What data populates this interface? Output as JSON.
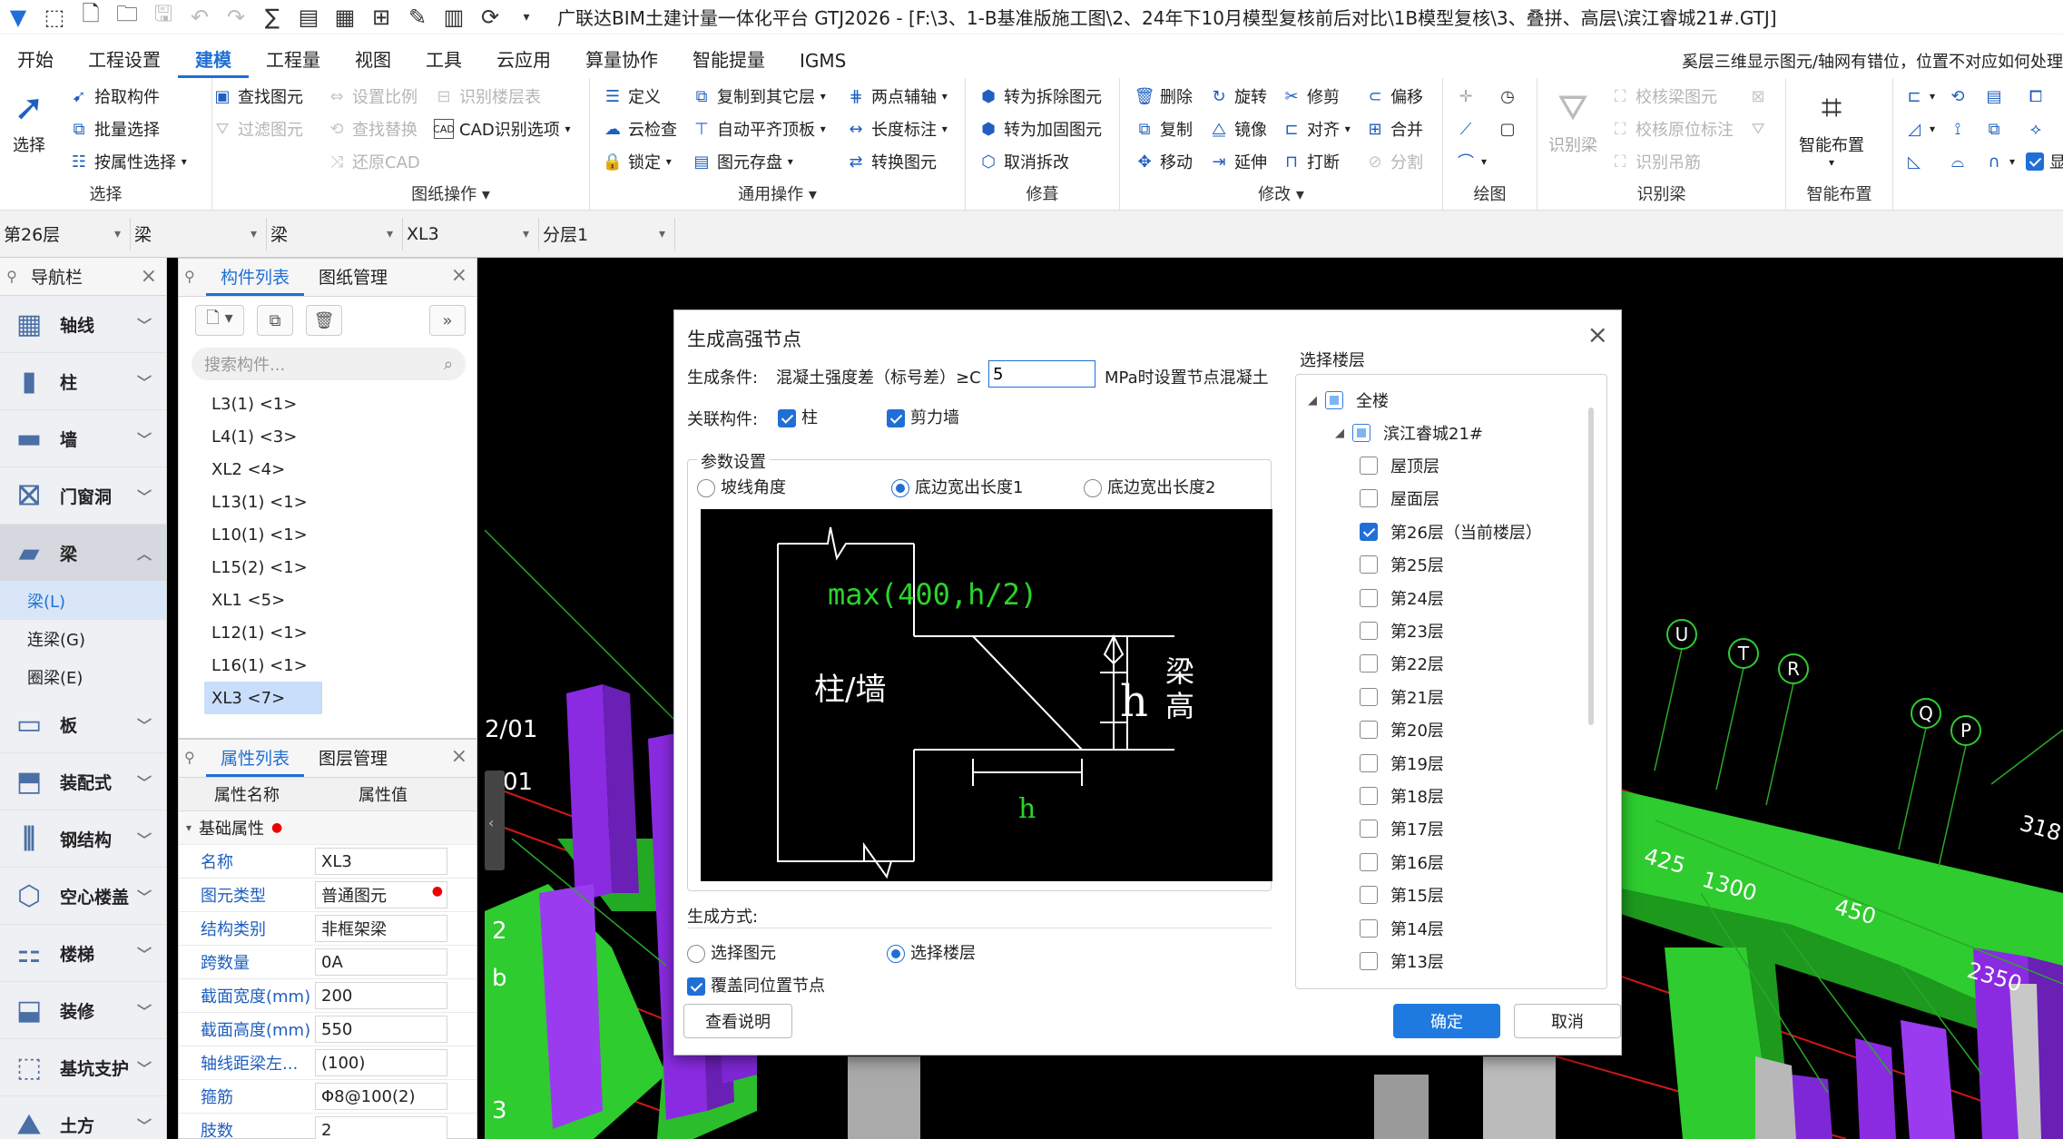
{
  "app": {
    "title": "广联达BIM土建计量一体化平台 GTJ2026 - [F:\\3、1-B基准版施工图\\2、24年下10月模型复核前后对比\\1B模型复核\\3、叠拼、高层\\滨江睿城21#.GTJ]",
    "notice": "奚层三维显示图元/轴网有错位，位置不对应如何处理"
  },
  "menus": [
    "开始",
    "工程设置",
    "建模",
    "工程量",
    "视图",
    "工具",
    "云应用",
    "算量协作",
    "智能提量",
    "IGMS"
  ],
  "active_menu": "建模",
  "ribbon": {
    "select_group": {
      "label": "选择",
      "big": "选择",
      "items": [
        "拾取构件",
        "批量选择",
        "按属性选择"
      ]
    },
    "find_items": [
      "查找图元",
      "过滤图元"
    ],
    "drawing_ops": {
      "label": "图纸操作",
      "items": [
        "设置比例",
        "查找替换",
        "还原CAD",
        "识别楼层表",
        "CAD识别选项"
      ]
    },
    "general_ops": {
      "label": "通用操作",
      "items": [
        "定义",
        "云检查",
        "锁定",
        "复制到其它层",
        "自动平齐顶板",
        "图元存盘",
        "两点辅轴",
        "长度标注",
        "转换图元"
      ]
    },
    "modify_split": {
      "label": "修葺",
      "items": [
        "转为拆除图元",
        "转为加固图元",
        "取消拆改"
      ]
    },
    "modify": {
      "label": "修改",
      "items": [
        "删除",
        "旋转",
        "修剪",
        "偏移",
        "复制",
        "镜像",
        "对齐",
        "合并",
        "移动",
        "延伸",
        "打断",
        "分割"
      ]
    },
    "draw": {
      "label": "绘图"
    },
    "identify_beam": {
      "label": "识别梁",
      "big": "识别梁",
      "items": [
        "校核梁图元",
        "校核原位标注",
        "识别吊筋"
      ]
    },
    "smart_layout": {
      "label": "智能布置",
      "big": "智能布置"
    },
    "more_label": "显"
  },
  "selectors": [
    "第26层",
    "梁",
    "梁",
    "XL3",
    "分层1"
  ],
  "nav": {
    "title": "导航栏",
    "items": [
      {
        "label": "轴线",
        "icon": "grid-icon"
      },
      {
        "label": "柱",
        "icon": "column-icon"
      },
      {
        "label": "墙",
        "icon": "wall-icon"
      },
      {
        "label": "门窗洞",
        "icon": "door-window-icon"
      },
      {
        "label": "梁",
        "icon": "beam-icon",
        "open": true
      },
      {
        "label": "板",
        "icon": "slab-icon"
      },
      {
        "label": "装配式",
        "icon": "prefab-icon"
      },
      {
        "label": "钢结构",
        "icon": "steel-icon"
      },
      {
        "label": "空心楼盖",
        "icon": "hollow-floor-icon"
      },
      {
        "label": "楼梯",
        "icon": "stairs-icon"
      },
      {
        "label": "装修",
        "icon": "decoration-icon"
      },
      {
        "label": "基坑支护",
        "icon": "pit-support-icon"
      },
      {
        "label": "土方",
        "icon": "earthwork-icon"
      }
    ],
    "sub_items": [
      "梁(L)",
      "连梁(G)",
      "圈梁(E)"
    ],
    "active_sub": "梁(L)"
  },
  "components": {
    "tabs": [
      "构件列表",
      "图纸管理"
    ],
    "search_placeholder": "搜索构件...",
    "rows": [
      "L3(1) <1>",
      "L4(1) <3>",
      "XL2 <4>",
      "L13(1) <1>",
      "L10(1) <1>",
      "L15(2) <1>",
      "XL1 <5>",
      "L12(1) <1>",
      "L16(1) <1>",
      "XL3 <7>"
    ],
    "selected": "XL3 <7>"
  },
  "properties": {
    "tabs": [
      "属性列表",
      "图层管理"
    ],
    "header": [
      "属性名称",
      "属性值"
    ],
    "group": "基础属性",
    "rows": [
      {
        "name": "名称",
        "value": "XL3"
      },
      {
        "name": "图元类型",
        "value": "普通图元",
        "mark": true
      },
      {
        "name": "结构类别",
        "value": "非框架梁"
      },
      {
        "name": "跨数量",
        "value": "0A"
      },
      {
        "name": "截面宽度(mm)",
        "value": "200"
      },
      {
        "name": "截面高度(mm)",
        "value": "550"
      },
      {
        "name": "轴线距梁左...",
        "value": "(100)"
      },
      {
        "name": "箍筋",
        "value": "Φ8@100(2)"
      },
      {
        "name": "肢数",
        "value": "2"
      }
    ]
  },
  "viewport": {
    "axis_labels": [
      "U",
      "T",
      "R",
      "Q",
      "P"
    ],
    "dims": [
      "425",
      "1300",
      "450",
      "2350",
      "318"
    ],
    "side_labels": [
      "2/01",
      "01",
      "2",
      "b",
      "3"
    ]
  },
  "dialog": {
    "title": "生成高强节点",
    "condition_label": "生成条件:",
    "condition_text": "混凝土强度差（标号差）≥C",
    "condition_value": "5",
    "condition_suffix": "MPa时设置节点混凝土",
    "related_label": "关联构件:",
    "related": [
      {
        "label": "柱",
        "checked": true
      },
      {
        "label": "剪力墙",
        "checked": true
      }
    ],
    "params_legend": "参数设置",
    "param_options": [
      {
        "label": "坡线角度",
        "checked": false
      },
      {
        "label": "底边宽出长度1",
        "checked": true
      },
      {
        "label": "底边宽出长度2",
        "checked": false
      }
    ],
    "diagram": {
      "formula": "max(400,h/2)",
      "column_wall": "柱/墙",
      "h_label": "h",
      "beam_height_1": "梁",
      "beam_height_2": "高",
      "bottom_h": "h"
    },
    "method_label": "生成方式:",
    "method_options": [
      {
        "label": "选择图元",
        "checked": false
      },
      {
        "label": "选择楼层",
        "checked": true
      }
    ],
    "overwrite": {
      "label": "覆盖同位置节点",
      "checked": true
    },
    "floors_legend": "选择楼层",
    "floor_root": "全楼",
    "floor_project": "滨江睿城21#",
    "floors": [
      {
        "label": "屋顶层",
        "checked": false
      },
      {
        "label": "屋面层",
        "checked": false
      },
      {
        "label": "第26层（当前楼层）",
        "checked": true
      },
      {
        "label": "第25层",
        "checked": false
      },
      {
        "label": "第24层",
        "checked": false
      },
      {
        "label": "第23层",
        "checked": false
      },
      {
        "label": "第22层",
        "checked": false
      },
      {
        "label": "第21层",
        "checked": false
      },
      {
        "label": "第20层",
        "checked": false
      },
      {
        "label": "第19层",
        "checked": false
      },
      {
        "label": "第18层",
        "checked": false
      },
      {
        "label": "第17层",
        "checked": false
      },
      {
        "label": "第16层",
        "checked": false
      },
      {
        "label": "第15层",
        "checked": false
      },
      {
        "label": "第14层",
        "checked": false
      },
      {
        "label": "第13层",
        "checked": false
      }
    ],
    "help_button": "查看说明",
    "ok_button": "确定",
    "cancel_button": "取消"
  },
  "colors": {
    "accent": "#1f6fd6",
    "beam_green": "#2ecc2e",
    "column_purple": "#8a2be2",
    "dialog_diagram_bg": "#000000",
    "diagram_text_green": "#2bd42b"
  }
}
